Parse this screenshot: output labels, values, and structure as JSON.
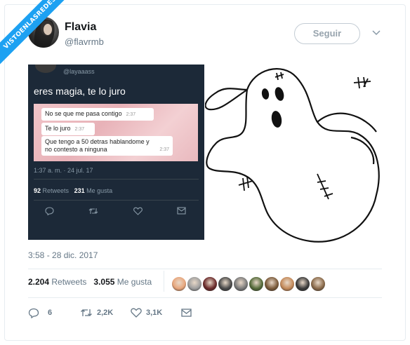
{
  "watermark": "VISTOENLASREDES",
  "user": {
    "name": "Flavia",
    "handle": "@flavrmb"
  },
  "follow_label": "Seguir",
  "embedded_tweet": {
    "handle": "@layaaass",
    "text": "eres magia, te lo juro",
    "messages": [
      {
        "text": "No se que me pasa contigo",
        "time": "2:37"
      },
      {
        "text": "Te lo juro",
        "time": "2:37"
      },
      {
        "text": "Que tengo a 50 detras hablandome y no contesto a ninguna",
        "time": "2:37"
      }
    ],
    "date": "1:37 a. m. · 24 jul. 17",
    "retweets_count": "92",
    "retweets_label": "Retweets",
    "likes_count": "231",
    "likes_label": "Me gusta"
  },
  "timestamp": "3:58 - 28 dic. 2017",
  "stats": {
    "retweets_count": "2.204",
    "retweets_label": "Retweets",
    "likes_count": "3.055",
    "likes_label": "Me gusta"
  },
  "likers": [
    {
      "color": "#e8a67c"
    },
    {
      "color": "#9e9e9e"
    },
    {
      "color": "#6b2b2b"
    },
    {
      "color": "#4a4a4a"
    },
    {
      "color": "#7a7a7a"
    },
    {
      "color": "#556b3a"
    },
    {
      "color": "#7a5a3a"
    },
    {
      "color": "#c48a5a"
    },
    {
      "color": "#3a3a3a"
    },
    {
      "color": "#8a6a4a"
    }
  ],
  "actions": {
    "replies": "6",
    "retweets": "2,2K",
    "likes": "3,1K"
  },
  "colors": {
    "accent": "#1da1f2",
    "muted": "#657786",
    "embedded_bg": "#1c2938"
  }
}
